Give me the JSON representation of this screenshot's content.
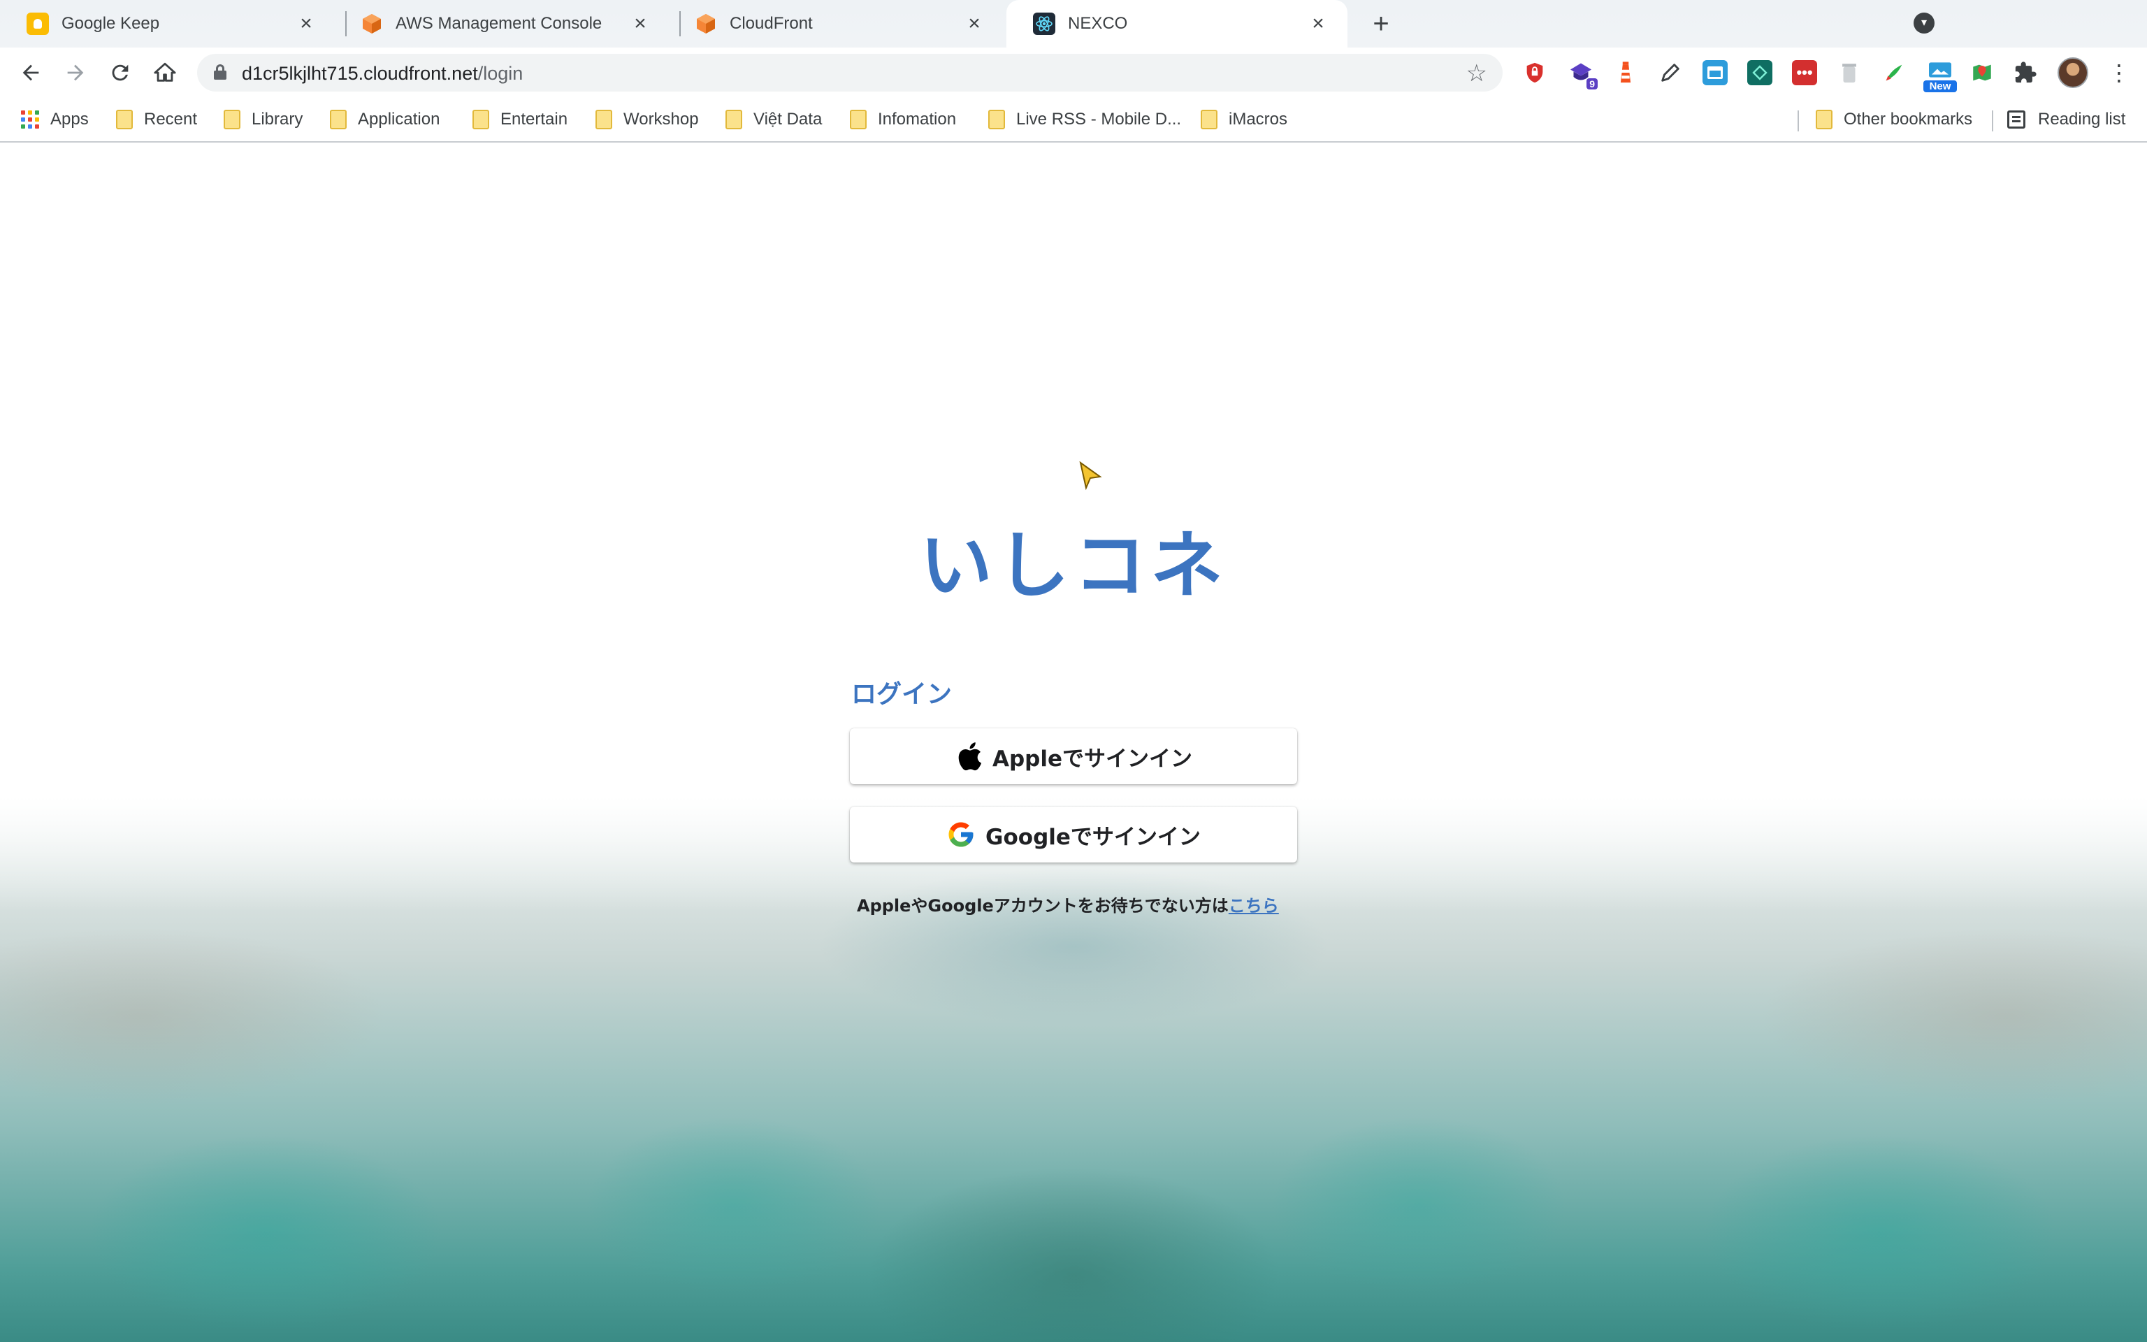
{
  "tabs": [
    {
      "title": "Google Keep",
      "favicon": "google-keep-icon",
      "active": false
    },
    {
      "title": "AWS Management Console",
      "favicon": "aws-cube-icon",
      "active": false
    },
    {
      "title": "CloudFront",
      "favicon": "aws-cube-icon",
      "active": false
    },
    {
      "title": "NEXCO",
      "favicon": "react-atom-icon",
      "active": true
    }
  ],
  "toolbar": {
    "url_host": "d1cr5lkjlht715.cloudfront.net",
    "url_path": "/login",
    "extension_badges": {
      "extension_9": "9",
      "extension_new": "New"
    }
  },
  "bookmarks": {
    "apps": "Apps",
    "folders": [
      "Recent",
      "Library",
      "Application",
      "Entertain",
      "Workshop",
      "Việt Data",
      "Infomation",
      "Live RSS - Mobile D...",
      "iMacros"
    ],
    "other": "Other bookmarks",
    "reading_list": "Reading list"
  },
  "page": {
    "brand": "いしコネ",
    "login_title": "ログイン",
    "apple_signin": "Appleでサインイン",
    "google_signin": "Googleでサインイン",
    "signup_note": "AppleやGoogleアカウントをお待ちでない方は",
    "signup_link": "こちら"
  },
  "colors": {
    "brand_blue": "#3c74c0",
    "tab_active": "#ffffff",
    "chrome_bg": "#eef2f5"
  }
}
